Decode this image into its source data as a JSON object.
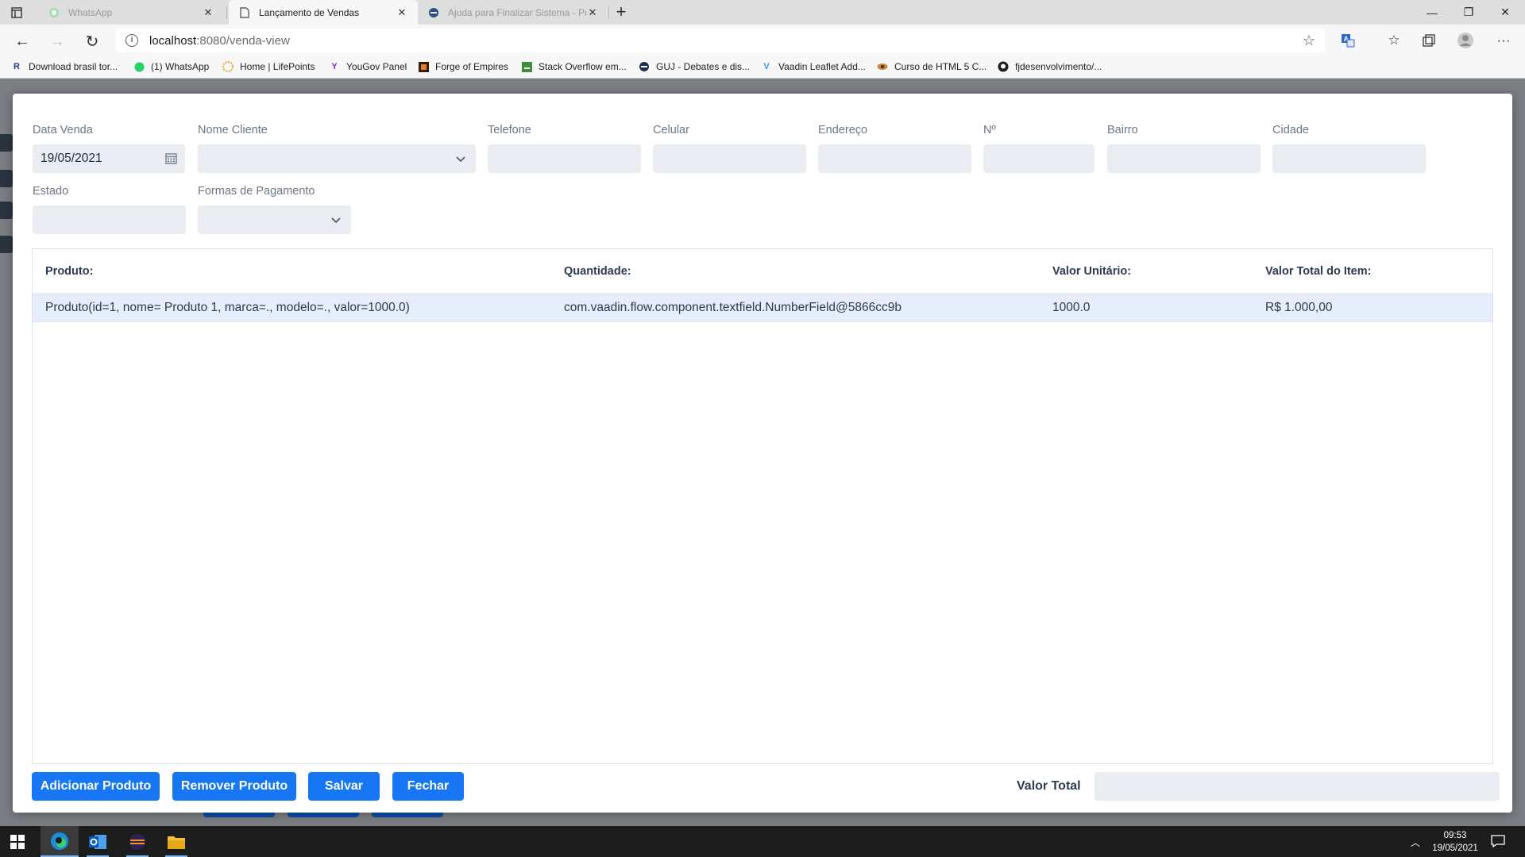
{
  "browser": {
    "tabs": [
      {
        "title": "WhatsApp",
        "state": "inactive",
        "icon": "whatsapp-icon"
      },
      {
        "title": "Lançamento de Vendas",
        "state": "active",
        "icon": "page-icon"
      },
      {
        "title": "Ajuda para Finalizar Sistema - Pr",
        "state": "inactive",
        "icon": "guj-icon"
      }
    ],
    "url_host": "localhost",
    "url_path": ":8080/venda-view",
    "bookmarks": [
      "Download brasil tor...",
      "(1) WhatsApp",
      "Home | LifePoints",
      "YouGov Panel",
      "Forge of Empires",
      "Stack Overflow em...",
      "GUJ - Debates e dis...",
      "Vaadin Leaflet Add...",
      "Curso de HTML 5 C...",
      "fjdesenvolvimento/..."
    ]
  },
  "form": {
    "data_venda": {
      "label": "Data Venda",
      "value": "19/05/2021"
    },
    "nome_cliente": {
      "label": "Nome Cliente",
      "value": ""
    },
    "telefone": {
      "label": "Telefone",
      "value": ""
    },
    "celular": {
      "label": "Celular",
      "value": ""
    },
    "endereco": {
      "label": "Endereço",
      "value": ""
    },
    "numero": {
      "label": "Nº",
      "value": ""
    },
    "bairro": {
      "label": "Bairro",
      "value": ""
    },
    "cidade": {
      "label": "Cidade",
      "value": ""
    },
    "estado": {
      "label": "Estado",
      "value": ""
    },
    "formas_pagamento": {
      "label": "Formas de Pagamento",
      "value": ""
    }
  },
  "grid": {
    "headers": [
      "Produto:",
      "Quantidade:",
      "Valor Unitário:",
      "Valor Total do Item:"
    ],
    "rows": [
      [
        "Produto(id=1, nome= Produto 1, marca=., modelo=., valor=1000.0)",
        "com.vaadin.flow.component.textfield.NumberField@5866cc9b",
        "1000.0",
        "R$ 1.000,00"
      ]
    ]
  },
  "actions": {
    "add": "Adicionar Produto",
    "remove": "Remover Produto",
    "save": "Salvar",
    "close": "Fechar"
  },
  "total": {
    "label": "Valor Total",
    "value": ""
  },
  "taskbar": {
    "time": "09:53",
    "date": "19/05/2021"
  },
  "colors": {
    "primary": "#1676f3",
    "field_bg": "#e9ecf0",
    "row_selected": "#e6eefb"
  }
}
